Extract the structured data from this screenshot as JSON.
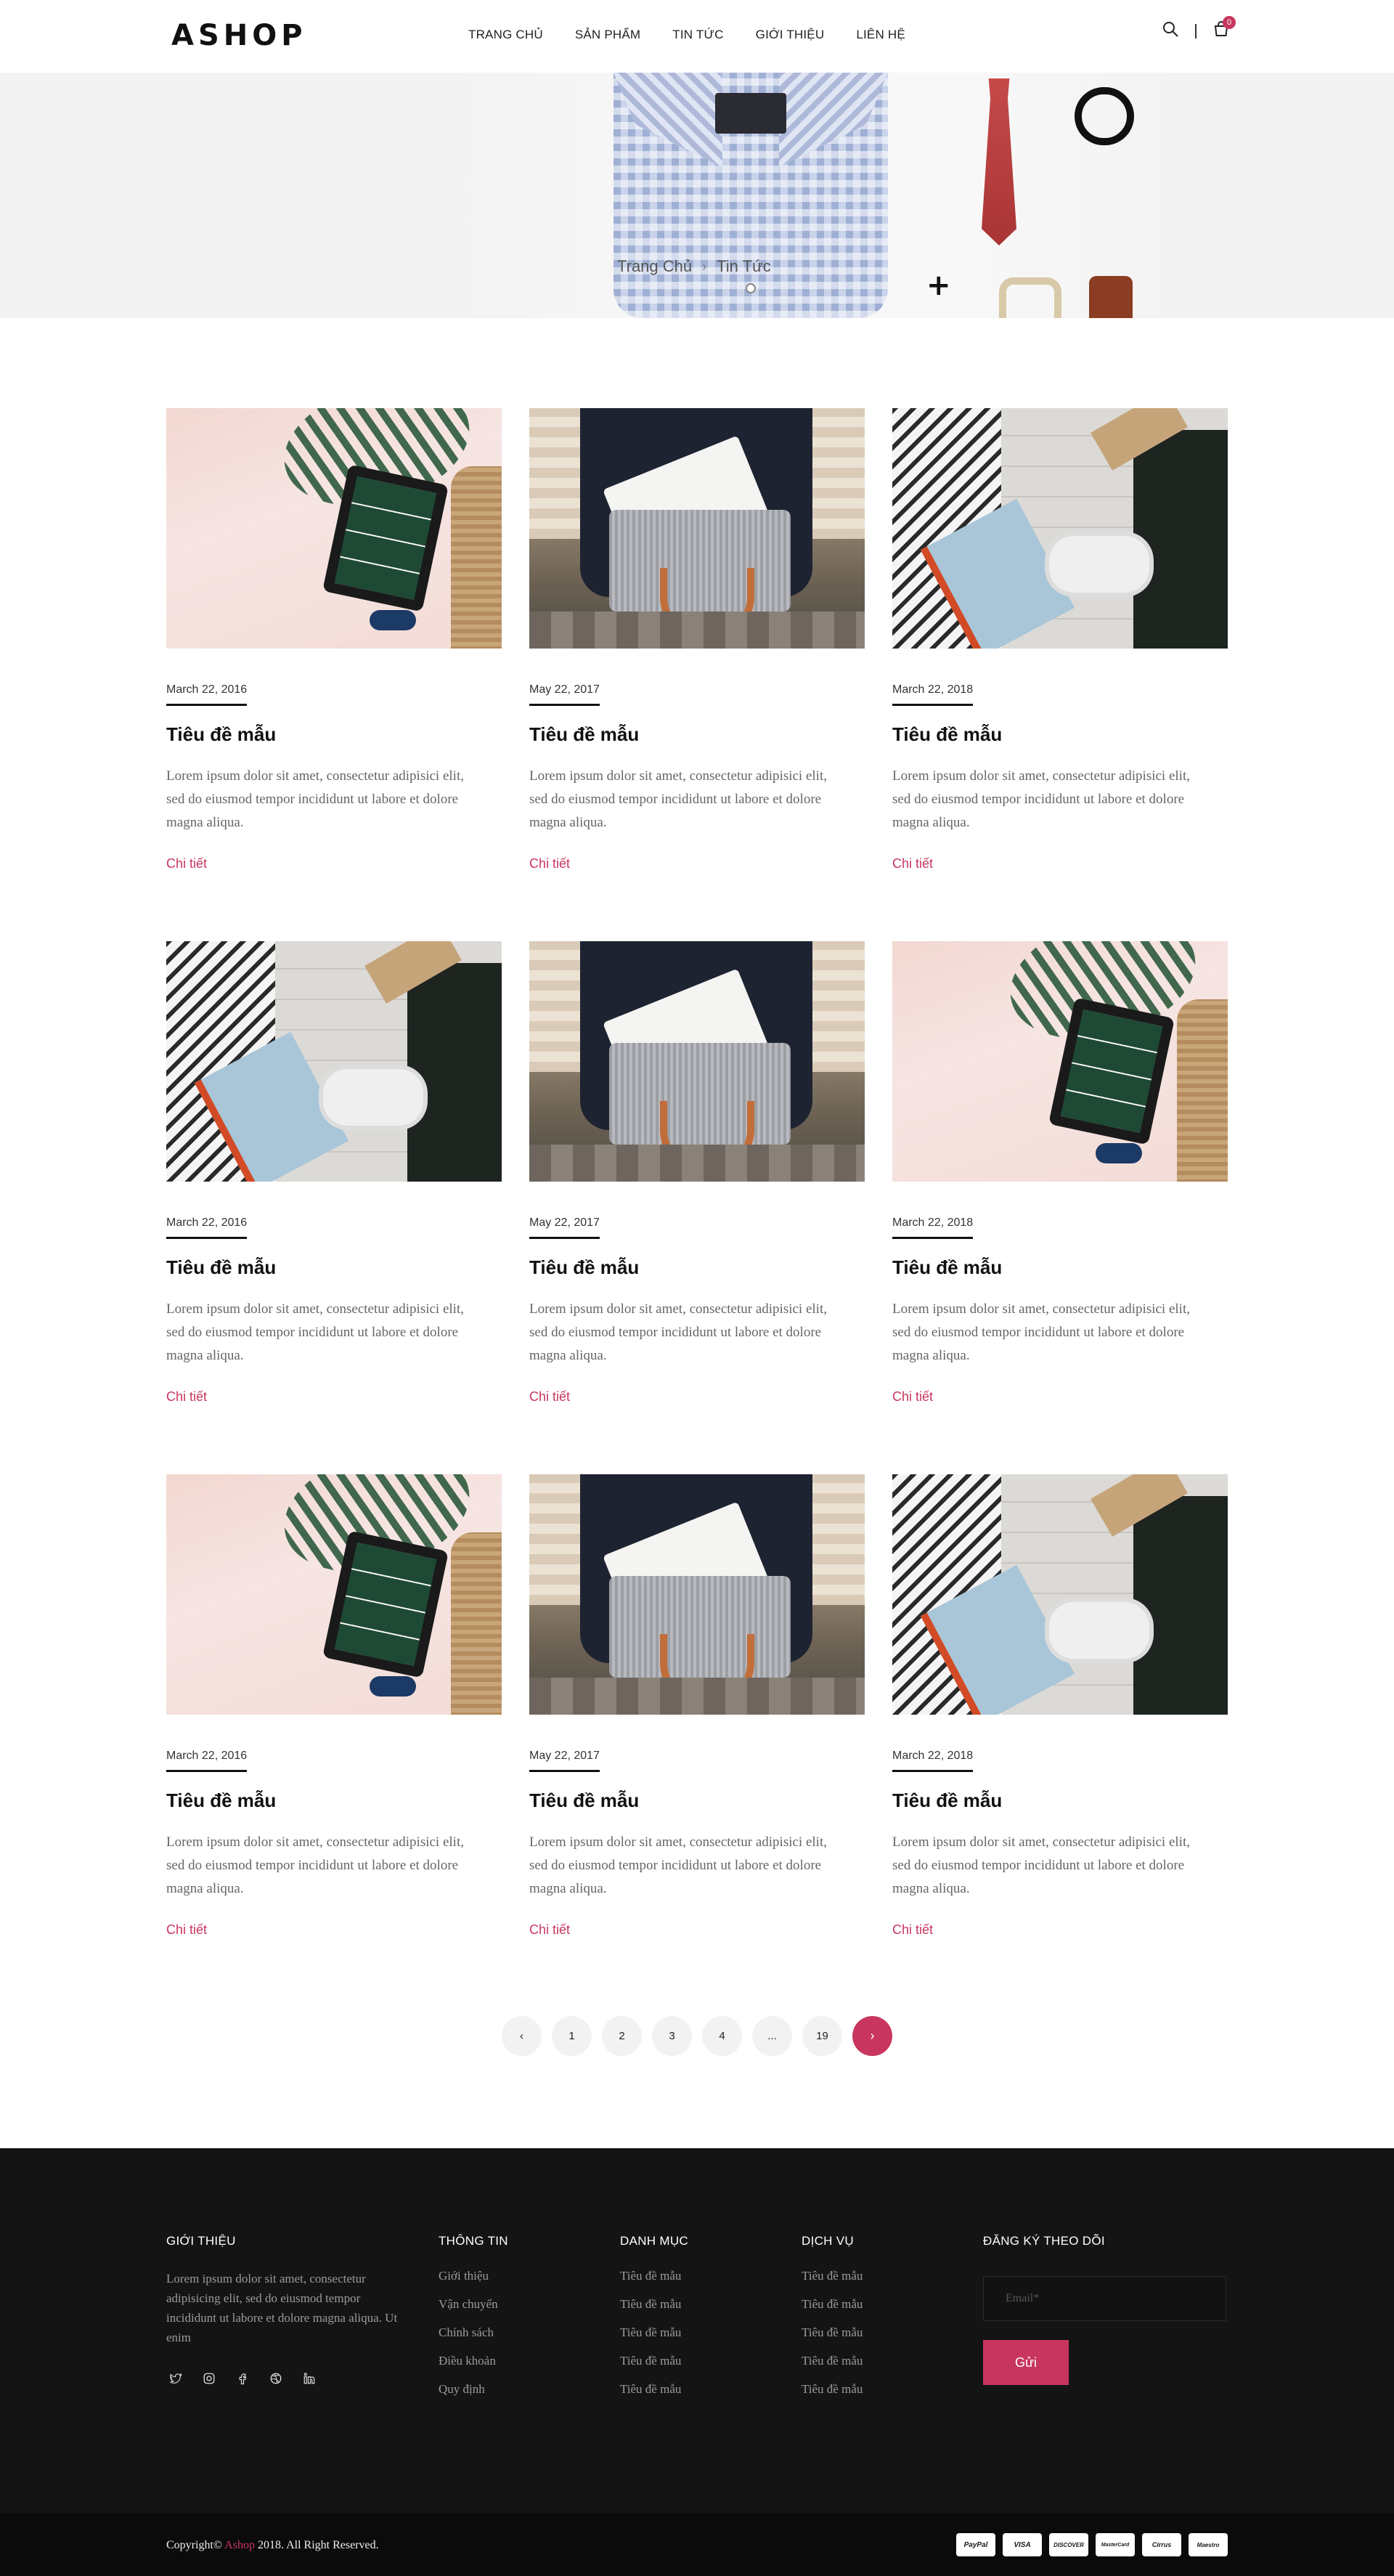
{
  "header": {
    "logo": "ASHOP",
    "nav": [
      "TRANG CHỦ",
      "SẢN PHẨM",
      "TIN TỨC",
      "GIỚI THIỆU",
      "LIÊN HỆ"
    ],
    "cart_count": "0",
    "search_icon": "search-icon",
    "cart_icon": "shopping-bag-icon"
  },
  "banner": {
    "breadcrumb_home": "Trang Chủ",
    "breadcrumb_current": "Tin Tức"
  },
  "posts": [
    {
      "date": "March 22, 2016",
      "title": "Tiêu đề mẫu",
      "excerpt": "Lorem ipsum dolor sit amet, consectetur adipisici elit, sed do eiusmod tempor incididunt ut labore et dolore magna aliqua.",
      "more": "Chi tiết",
      "image": "tablet"
    },
    {
      "date": "May 22, 2017",
      "title": "Tiêu đề mẫu",
      "excerpt": "Lorem ipsum dolor sit amet, consectetur adipisici elit, sed do eiusmod tempor incididunt ut labore et dolore magna aliqua.",
      "more": "Chi tiết",
      "image": "bag"
    },
    {
      "date": "March 22, 2018",
      "title": "Tiêu đề mẫu",
      "excerpt": "Lorem ipsum dolor sit amet, consectetur adipisici elit, sed do eiusmod tempor incididunt ut labore et dolore magna aliqua.",
      "more": "Chi tiết",
      "image": "book"
    },
    {
      "date": "March 22, 2016",
      "title": "Tiêu đề mẫu",
      "excerpt": "Lorem ipsum dolor sit amet, consectetur adipisici elit, sed do eiusmod tempor incididunt ut labore et dolore magna aliqua.",
      "more": "Chi tiết",
      "image": "book"
    },
    {
      "date": "May 22, 2017",
      "title": "Tiêu đề mẫu",
      "excerpt": "Lorem ipsum dolor sit amet, consectetur adipisici elit, sed do eiusmod tempor incididunt ut labore et dolore magna aliqua.",
      "more": "Chi tiết",
      "image": "bag"
    },
    {
      "date": "March 22, 2018",
      "title": "Tiêu đề mẫu",
      "excerpt": "Lorem ipsum dolor sit amet, consectetur adipisici elit, sed do eiusmod tempor incididunt ut labore et dolore magna aliqua.",
      "more": "Chi tiết",
      "image": "tablet"
    },
    {
      "date": "March 22, 2016",
      "title": "Tiêu đề mẫu",
      "excerpt": "Lorem ipsum dolor sit amet, consectetur adipisici elit, sed do eiusmod tempor incididunt ut labore et dolore magna aliqua.",
      "more": "Chi tiết",
      "image": "tablet"
    },
    {
      "date": "May 22, 2017",
      "title": "Tiêu đề mẫu",
      "excerpt": "Lorem ipsum dolor sit amet, consectetur adipisici elit, sed do eiusmod tempor incididunt ut labore et dolore magna aliqua.",
      "more": "Chi tiết",
      "image": "bag"
    },
    {
      "date": "March 22, 2018",
      "title": "Tiêu đề mẫu",
      "excerpt": "Lorem ipsum dolor sit amet, consectetur adipisici elit, sed do eiusmod tempor incididunt ut labore et dolore magna aliqua.",
      "more": "Chi tiết",
      "image": "book"
    }
  ],
  "pagination": {
    "prev": "‹",
    "pages": [
      "1",
      "2",
      "3",
      "4",
      "...",
      "19"
    ],
    "next": "›"
  },
  "footer": {
    "about_title": "GIỚI THIỆU",
    "about_text": "Lorem ipsum dolor sit amet, consectetur adipisicing elit, sed do eiusmod tempor incididunt ut labore et dolore magna aliqua. Ut enim",
    "social": [
      "twitter-icon",
      "instagram-icon",
      "facebook-icon",
      "dribbble-icon",
      "linkedin-icon"
    ],
    "info_title": "THÔNG TIN",
    "info_links": [
      "Giới thiệu",
      "Vận chuyển",
      "Chính sách",
      "Điều khoản",
      "Quy định"
    ],
    "category_title": "DANH MỤC",
    "category_links": [
      "Tiêu đề mẫu",
      "Tiêu đề mẫu",
      "Tiêu đề mẫu",
      "Tiêu đề mẫu",
      "Tiêu đề mẫu"
    ],
    "service_title": "DỊCH VỤ",
    "service_links": [
      "Tiêu đề mẫu",
      "Tiêu đề mẫu",
      "Tiêu đề mẫu",
      "Tiêu đề mẫu",
      "Tiêu đề mẫu"
    ],
    "subscribe_title": "ĐĂNG KÝ THEO DÕI",
    "email_placeholder": "Email*",
    "submit_label": "Gửi"
  },
  "copyright": {
    "prefix": "Copyright© ",
    "brand": "Ashop",
    "suffix": " 2018. All Right Reserved.",
    "payments": [
      "PayPal",
      "VISA",
      "DISCOVER",
      "MasterCard",
      "Cirrus",
      "Maestro"
    ]
  },
  "colors": {
    "accent": "#c8365f",
    "footer_bg": "#141414"
  }
}
